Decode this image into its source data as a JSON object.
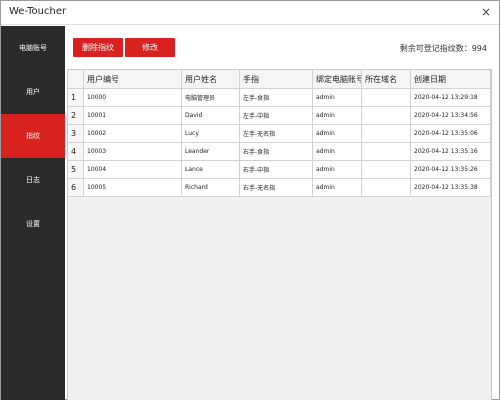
{
  "window": {
    "title": "We-Toucher",
    "close_glyph": "×"
  },
  "sidebar": {
    "items": [
      "电脑账号",
      "用户",
      "指纹",
      "日志",
      "设置"
    ],
    "active": "指纹"
  },
  "toolbar": {
    "delete_label": "删除指纹",
    "edit_label": "修改",
    "remaining_text": "剩余可登记指纹数：994"
  },
  "table": {
    "headers": [
      "用户编号",
      "用户姓名",
      "手指",
      "绑定电脑账号",
      "所在域名",
      "创建日期"
    ],
    "rows": [
      {
        "index": "1",
        "id": "10000",
        "name": "电脑管理员",
        "finger": "左手-食指",
        "account": "admin",
        "domain": "",
        "created": "2020-04-12 13:29:18"
      },
      {
        "index": "2",
        "id": "10001",
        "name": "David",
        "finger": "左手-中指",
        "account": "admin",
        "domain": "",
        "created": "2020-04-12 13:34:56"
      },
      {
        "index": "3",
        "id": "10002",
        "name": "Lucy",
        "finger": "左手-无名指",
        "account": "admin",
        "domain": "",
        "created": "2020-04-12 13:35:06"
      },
      {
        "index": "4",
        "id": "10003",
        "name": "Leander",
        "finger": "右手-食指",
        "account": "admin",
        "domain": "",
        "created": "2020-04-12 13:35:16"
      },
      {
        "index": "5",
        "id": "10004",
        "name": "Lance",
        "finger": "右手-中指",
        "account": "admin",
        "domain": "",
        "created": "2020-04-12 13:35:26"
      },
      {
        "index": "6",
        "id": "10005",
        "name": "Richard",
        "finger": "右手-无名指",
        "account": "admin",
        "domain": "",
        "created": "2020-04-12 13:35:38"
      }
    ]
  },
  "colors": {
    "accent": "#d9221f",
    "sidebar": "#2a2a2a"
  }
}
